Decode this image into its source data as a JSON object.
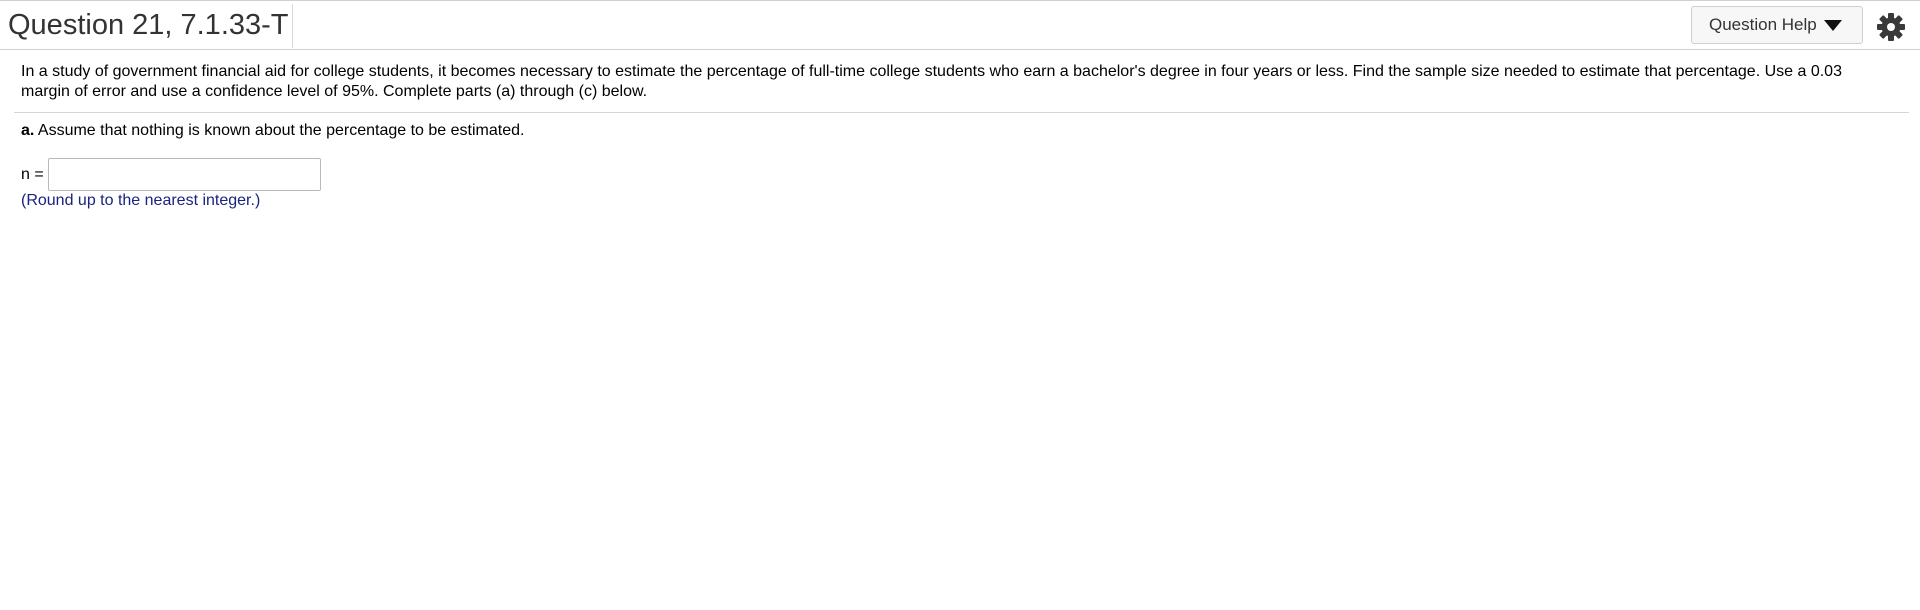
{
  "header": {
    "question_title": "Question 21, 7.1.33-T",
    "help_button_label": "Question Help",
    "help_caret_icon": "caret-down-icon",
    "settings_icon": "gear-icon"
  },
  "problem": {
    "text": "In a study of government financial aid for college students, it becomes necessary to estimate the percentage of full-time college students who earn a bachelor's degree in four years or less. Find the sample size needed to estimate that percentage. Use a 0.03 margin of error and use a confidence level of 95%. Complete parts (a) through (c) below."
  },
  "part_a": {
    "label": "a.",
    "text": "Assume that nothing is known about the percentage to be estimated.",
    "answer_label": "n =",
    "answer_value": "",
    "hint": "(Round up to the nearest integer.)"
  },
  "colors": {
    "hint_text": "#1a237e",
    "title_text": "#333333"
  }
}
